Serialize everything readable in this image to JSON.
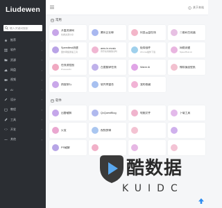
{
  "sidebar": {
    "brand": "Liudewen",
    "search_placeholder": "输入关键词搜索",
    "items": [
      {
        "label": "推荐",
        "icon": "star-icon"
      },
      {
        "label": "软件",
        "icon": "grid-icon"
      },
      {
        "label": "资源",
        "icon": "folder-icon"
      },
      {
        "label": "网盘",
        "icon": "cloud-icon"
      },
      {
        "label": "视频",
        "icon": "video-icon"
      },
      {
        "label": "AI",
        "icon": "chip-icon"
      },
      {
        "label": "设计",
        "icon": "pen-icon"
      },
      {
        "label": "教程",
        "icon": "book-icon"
      },
      {
        "label": "工具",
        "icon": "wrench-icon"
      },
      {
        "label": "开发",
        "icon": "code-icon"
      },
      {
        "label": "其他",
        "icon": "dots-icon"
      }
    ]
  },
  "topbar": {
    "right_link": "关于本站"
  },
  "sections": [
    {
      "title": "常用",
      "cards": [
        {
          "name": "开盖资源网",
          "desc": "优质资源分享",
          "color": "#c7a6e8"
        },
        {
          "name": "腾讯企业邮",
          "desc": "",
          "color": "#a9b8f0"
        },
        {
          "name": "阿里云盘在线",
          "desc": "",
          "color": "#f3b6c9"
        },
        {
          "name": "二维码生成器",
          "desc": "",
          "color": "#e7c0e3"
        },
        {
          "name": "Speedtest测速",
          "desc": "国外网络测速工具",
          "color": "#b9a3e6"
        },
        {
          "name": "ams.in.music",
          "desc": "音乐在线播放试听",
          "color": "#f0b6d2"
        },
        {
          "name": "极简插件",
          "desc": "chrome插件下载",
          "color": "#9fd0ec"
        },
        {
          "name": "网络测速",
          "desc": "SpeedTest.cn",
          "color": "#e9b5e0"
        },
        {
          "name": "在线流程图",
          "desc": "ProcessOn",
          "color": "#f0a9c1"
        },
        {
          "name": "百度翻译在线",
          "desc": "",
          "color": "#bfb1ea"
        },
        {
          "name": "Warm AI",
          "desc": "",
          "color": "#e0a4e6"
        },
        {
          "name": "微软桌面壁纸",
          "desc": "",
          "color": "#f2c0cf"
        },
        {
          "name": "热搜排行",
          "desc": "",
          "color": "#c9a7e9"
        },
        {
          "name": "软件库整合",
          "desc": "",
          "color": "#a7c0f0"
        },
        {
          "name": "我的收藏",
          "desc": "",
          "color": "#f1b3d5"
        }
      ]
    },
    {
      "title": "软件",
      "cards": [
        {
          "name": "迅雷破解",
          "desc": "",
          "color": "#c5a6ea"
        },
        {
          "name": "QxQuestBlog",
          "desc": "",
          "color": "#b0b9ee"
        },
        {
          "name": "电脑文件",
          "desc": "",
          "color": "#f0b4cd"
        },
        {
          "name": "下载工具",
          "desc": "",
          "color": "#e3b9ea"
        },
        {
          "name": "火萤",
          "desc": "",
          "color": "#eaa7d0"
        },
        {
          "name": "视频剪辑",
          "desc": "",
          "color": "#a9c6f0"
        },
        {
          "name": "",
          "desc": "",
          "color": "#f3c2d2"
        },
        {
          "name": "",
          "desc": "",
          "color": "#cfb0ec"
        },
        {
          "name": "PS破解",
          "desc": "",
          "color": "#b7a5e6"
        },
        {
          "name": "",
          "desc": "",
          "color": "#f1b0c8"
        },
        {
          "name": "",
          "desc": "",
          "color": "#e6b7e4"
        },
        {
          "name": "",
          "desc": "",
          "color": "#f3c3d4"
        }
      ]
    }
  ],
  "watermark": {
    "title": "酷数据",
    "sub": "KUIDC"
  }
}
